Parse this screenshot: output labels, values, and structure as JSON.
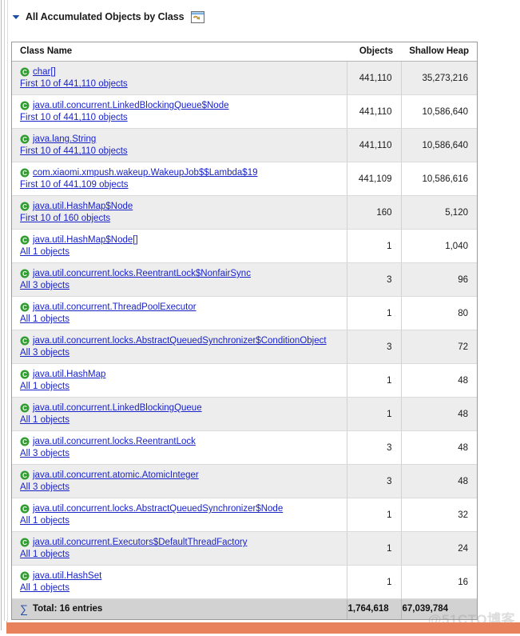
{
  "header": {
    "title": "All Accumulated Objects by Class",
    "twisty_icon": "chevron-down-icon",
    "view_icon": "open-view-window-icon"
  },
  "table": {
    "columns": [
      "Class Name",
      "Objects",
      "Shallow Heap"
    ],
    "rows": [
      {
        "class_name": "char[]",
        "sub": "First 10 of 441,110 objects",
        "objects": "441,110",
        "shallow_heap": "35,273,216"
      },
      {
        "class_name": "java.util.concurrent.LinkedBlockingQueue$Node",
        "sub": "First 10 of 441,110 objects",
        "objects": "441,110",
        "shallow_heap": "10,586,640"
      },
      {
        "class_name": "java.lang.String",
        "sub": "First 10 of 441,110 objects",
        "objects": "441,110",
        "shallow_heap": "10,586,640"
      },
      {
        "class_name": "com.xiaomi.xmpush.wakeup.WakeupJob$$Lambda$19",
        "sub": "First 10 of 441,109 objects",
        "objects": "441,109",
        "shallow_heap": "10,586,616"
      },
      {
        "class_name": "java.util.HashMap$Node",
        "sub": "First 10 of 160 objects",
        "objects": "160",
        "shallow_heap": "5,120"
      },
      {
        "class_name": "java.util.HashMap$Node[]",
        "sub": "All 1 objects",
        "objects": "1",
        "shallow_heap": "1,040"
      },
      {
        "class_name": "java.util.concurrent.locks.ReentrantLock$NonfairSync",
        "sub": "All 3 objects",
        "objects": "3",
        "shallow_heap": "96"
      },
      {
        "class_name": "java.util.concurrent.ThreadPoolExecutor",
        "sub": "All 1 objects",
        "objects": "1",
        "shallow_heap": "80"
      },
      {
        "class_name": "java.util.concurrent.locks.AbstractQueuedSynchronizer$ConditionObject",
        "sub": "All 3 objects",
        "objects": "3",
        "shallow_heap": "72"
      },
      {
        "class_name": "java.util.HashMap",
        "sub": "All 1 objects",
        "objects": "1",
        "shallow_heap": "48"
      },
      {
        "class_name": "java.util.concurrent.LinkedBlockingQueue",
        "sub": "All 1 objects",
        "objects": "1",
        "shallow_heap": "48"
      },
      {
        "class_name": "java.util.concurrent.locks.ReentrantLock",
        "sub": "All 3 objects",
        "objects": "3",
        "shallow_heap": "48"
      },
      {
        "class_name": "java.util.concurrent.atomic.AtomicInteger",
        "sub": "All 3 objects",
        "objects": "3",
        "shallow_heap": "48"
      },
      {
        "class_name": "java.util.concurrent.locks.AbstractQueuedSynchronizer$Node",
        "sub": "All 1 objects",
        "objects": "1",
        "shallow_heap": "32"
      },
      {
        "class_name": "java.util.concurrent.Executors$DefaultThreadFactory",
        "sub": "All 1 objects",
        "objects": "1",
        "shallow_heap": "24"
      },
      {
        "class_name": "java.util.HashSet",
        "sub": "All 1 objects",
        "objects": "1",
        "shallow_heap": "16"
      }
    ],
    "total": {
      "label": "Total: 16 entries",
      "sigma": "∑",
      "objects": "1,764,618",
      "shallow_heap": "67,039,784"
    },
    "row_icon": "class-c-icon"
  },
  "watermark": {
    "text": "@51CTO博客"
  },
  "colors": {
    "link": "#1a23c8",
    "class_icon": "#2f9e2f",
    "row_stripe": "#ededed",
    "total_row": "#d2d2d2",
    "accent_band": "#e8825d"
  }
}
